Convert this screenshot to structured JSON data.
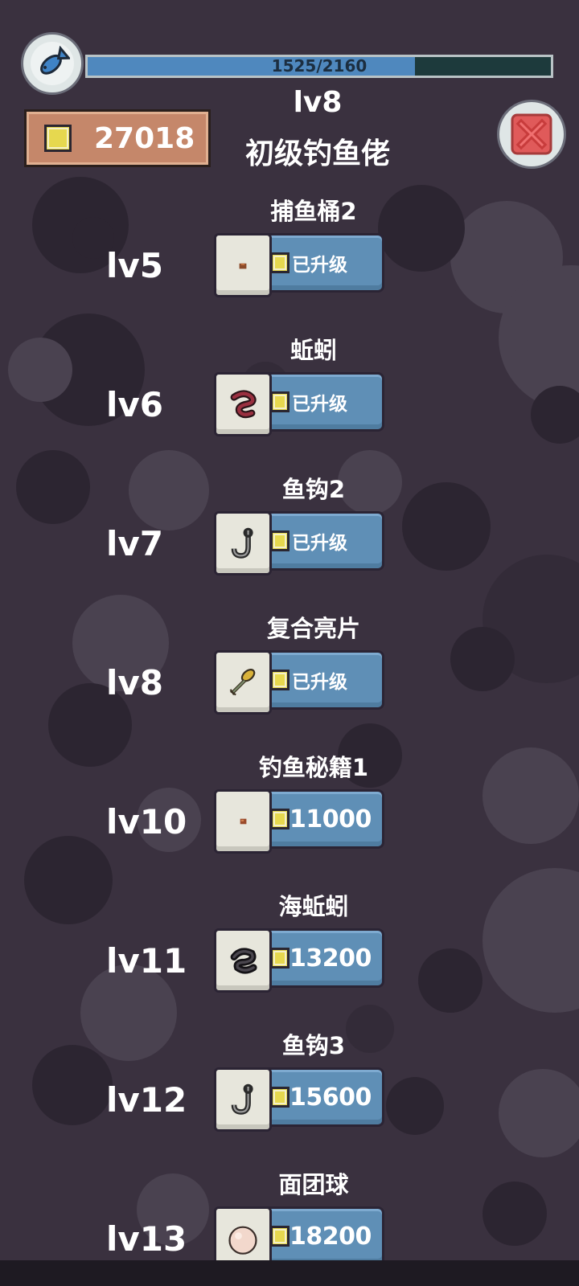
{
  "player": {
    "xp_text": "1525/2160",
    "xp_current": 1525,
    "xp_max": 2160,
    "level": "lv8",
    "title": "初级钓鱼佬",
    "coins": "27018",
    "avatar_icon": "fish-icon"
  },
  "close_icon": "close-x-icon",
  "items": [
    {
      "name": "捕鱼桶2",
      "level": "lv5",
      "button": "已升级",
      "icon": "pellet-icon",
      "upgraded": true
    },
    {
      "name": "蚯蚓",
      "level": "lv6",
      "button": "已升级",
      "icon": "worm-icon",
      "upgraded": true
    },
    {
      "name": "鱼钩2",
      "level": "lv7",
      "button": "已升级",
      "icon": "hook-icon",
      "upgraded": true
    },
    {
      "name": "复合亮片",
      "level": "lv8",
      "button": "已升级",
      "icon": "spinner-lure-icon",
      "upgraded": true
    },
    {
      "name": "钓鱼秘籍1",
      "level": "lv10",
      "button": "11000",
      "icon": "book-icon",
      "upgraded": false
    },
    {
      "name": "海蚯蚓",
      "level": "lv11",
      "button": "13200",
      "icon": "sea-worm-icon",
      "upgraded": false
    },
    {
      "name": "鱼钩3",
      "level": "lv12",
      "button": "15600",
      "icon": "hook-icon",
      "upgraded": false
    },
    {
      "name": "面团球",
      "level": "lv13",
      "button": "18200",
      "icon": "dough-ball-icon",
      "upgraded": false
    }
  ],
  "colors": {
    "background": "#3a313f",
    "button_blue": "#5f8fb6",
    "coin_yellow": "#e6d84f",
    "coin_box": "#c5876a",
    "xp_fill": "#4f88be",
    "close_red": "#e05a5a"
  }
}
